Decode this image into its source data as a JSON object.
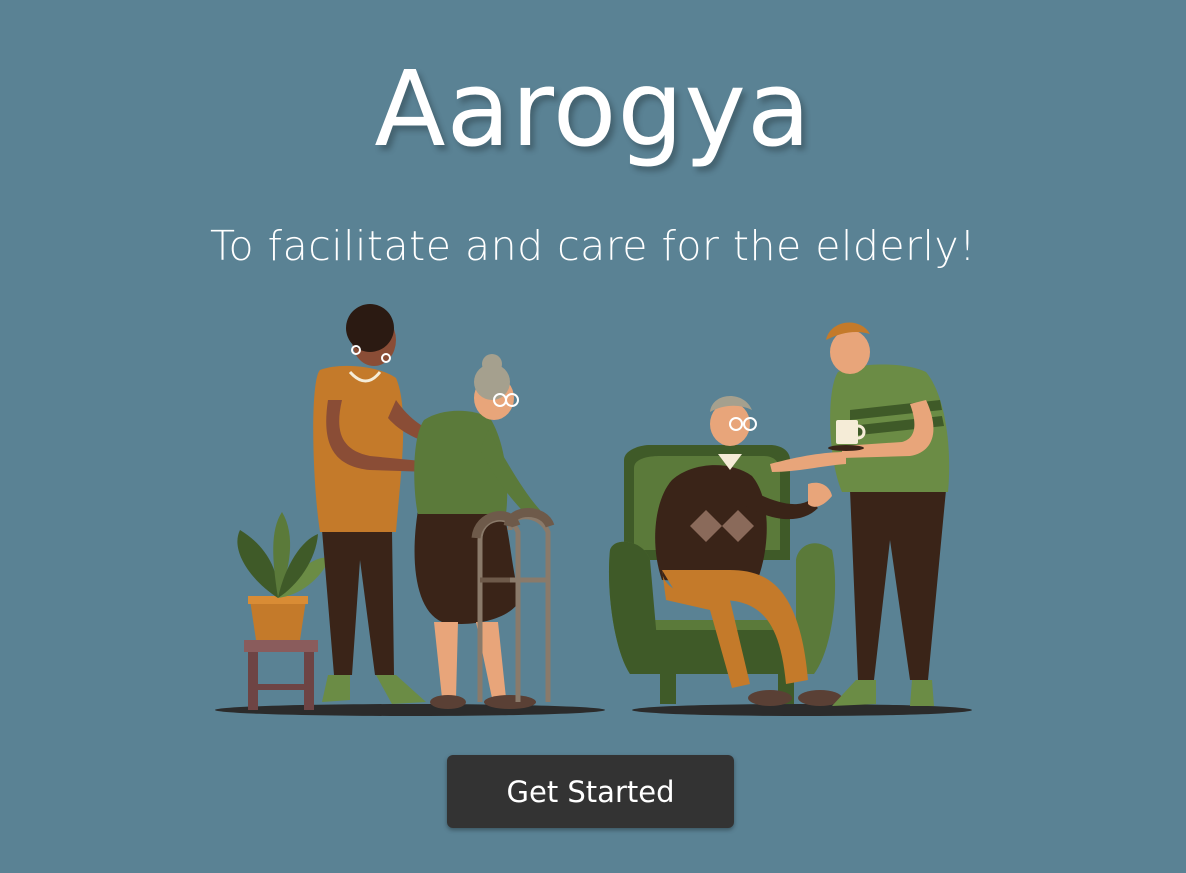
{
  "hero": {
    "title": "Aarogya",
    "subtitle": "To facilitate and care for the elderly!"
  },
  "illustration": {
    "description_icon": "caregivers-with-elderly-illustration"
  },
  "cta": {
    "label": "Get Started"
  },
  "colors": {
    "background": "#5a8294",
    "text": "#ffffff",
    "button_bg": "#333333"
  }
}
